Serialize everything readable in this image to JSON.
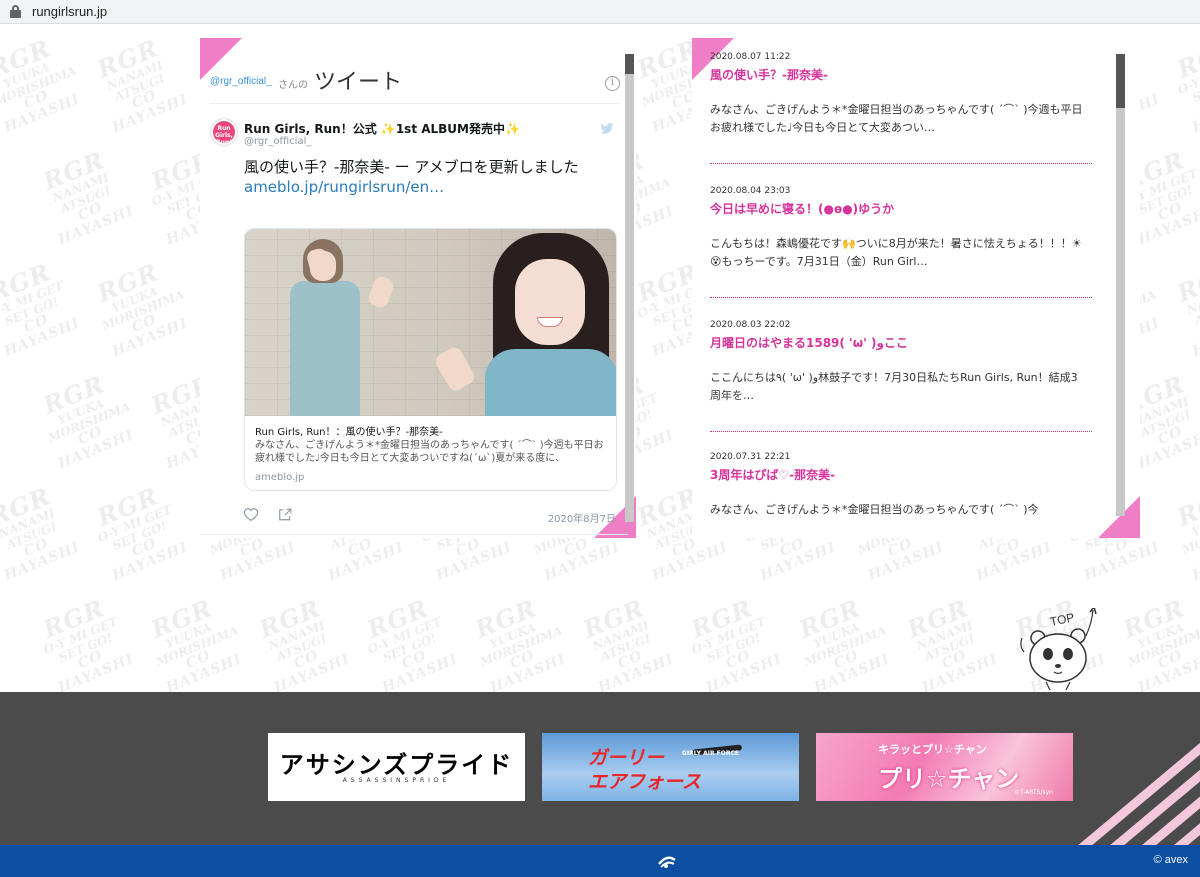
{
  "browser": {
    "url": "rungirlsrun.jp"
  },
  "tweet_widget": {
    "handle_small": "@rgr_official_",
    "san": "さんの",
    "title": "ツイート",
    "info_glyph": "i",
    "avatar_text": "Run Girls, Run!",
    "author_name": "Run Girls, Run！公式 ✨1st ALBUM発売中✨",
    "author_handle": "@rgr_official_",
    "text": "風の使い手？-那奈美- ー アメブロを更新しました",
    "link": "ameblo.jp/rungirlsrun/en…",
    "card": {
      "title": "Run Girls, Run！：風の使い手？-那奈美-",
      "description": "みなさん、ごきげんよう＊*金曜日担当のあっちゃんです( ´⌒` )今週も平日お疲れ様でした♩今日も今日とて大変あついですね(´ω`)夏が来る度に、",
      "domain": "ameblo.jp"
    },
    "date": "2020年8月7日"
  },
  "blog_posts": [
    {
      "date": "2020.08.07 11:22",
      "title": "風の使い手？-那奈美-",
      "body": "みなさん、ごきげんよう＊*金曜日担当のあっちゃんです( ´⌒` )今週も平日お疲れ様でした♩今日も今日とて大変あつい…"
    },
    {
      "date": "2020.08.04 23:03",
      "title": "今日は早めに寝る！(●ө●)ゆうか",
      "body": "こんもちは！森嶋優花です🙌ついに8月が来た！暑さに怯えちょる！！！☀😵もっちーです。7月31日（金）Run Girl…"
    },
    {
      "date": "2020.08.03 22:02",
      "title": "月曜日のはやまる1589( 'ω' )وここ",
      "body": "ここんにちは٩( 'ω' )و林鼓子です！7月30日私たちRun Girls, Run！結成3周年を…"
    },
    {
      "date": "2020.07.31 22:21",
      "title": "3周年はぴば♡-那奈美-",
      "body": "みなさん、ごきげんよう＊*金曜日担当のあっちゃんです( ´⌒` )今"
    }
  ],
  "top_button": {
    "label": "TOP"
  },
  "watermark": {
    "line1": "RGR",
    "line2": "YUUKA MORISHIMA",
    "line3": "CO HAYASHI",
    "line4": "NANAMI ATSUGI",
    "line5": "O-Y MI GET SET GO!"
  },
  "banners": [
    {
      "name": "assassins-pride",
      "title": "アサシンズプライド",
      "subtitle": "ASSASSINSPRIDE"
    },
    {
      "name": "girly-air-force",
      "title_line1": "ガーリー",
      "title_line2": "エアフォース",
      "subtitle": "GIRLY AIR FORCE"
    },
    {
      "name": "kiratto-pri-chan",
      "title_line1": "キラッとプリ☆チャン",
      "title_line2": "プリ☆チャン",
      "credit": "©T-ARTS/syn"
    }
  ],
  "footer": {
    "copyright": "© avex"
  },
  "colors": {
    "accent_pink": "#f07ec7",
    "post_title": "#d6339b",
    "footer_dark": "#4b4b4b",
    "footer_blue": "#0b4ea2",
    "tweet_link": "#2b7bb9"
  }
}
